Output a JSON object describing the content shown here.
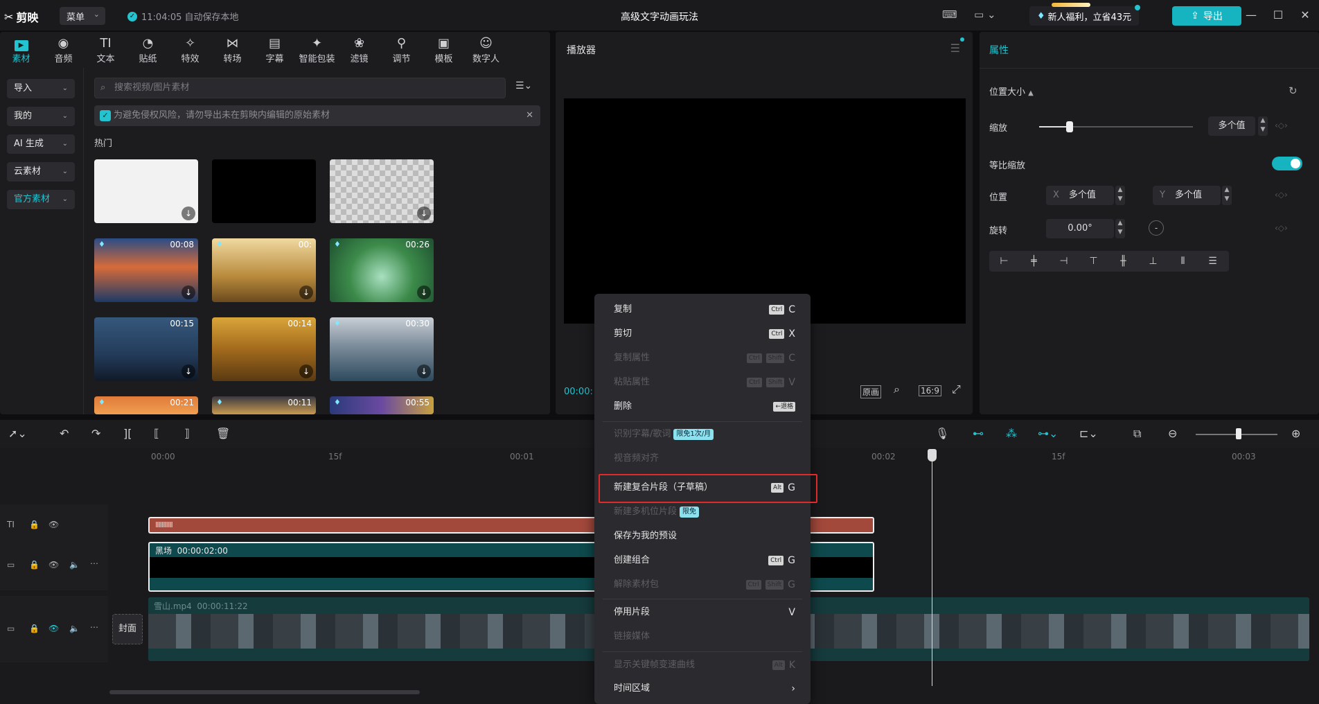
{
  "titlebar": {
    "app_name": "剪映",
    "menu_label": "菜单",
    "autosave_text": "11:04:05 自动保存本地",
    "window_title": "高级文字动画玩法",
    "promo_label": "新人福利，立省43元",
    "export_label": "导出"
  },
  "media_tabs": [
    {
      "label": "素材",
      "icon": "media-icon"
    },
    {
      "label": "音频",
      "icon": "audio-icon"
    },
    {
      "label": "文本",
      "icon": "text-icon"
    },
    {
      "label": "贴纸",
      "icon": "sticker-icon"
    },
    {
      "label": "特效",
      "icon": "effects-icon"
    },
    {
      "label": "转场",
      "icon": "transition-icon"
    },
    {
      "label": "字幕",
      "icon": "caption-icon"
    },
    {
      "label": "智能包装",
      "icon": "smart-pack-icon"
    },
    {
      "label": "滤镜",
      "icon": "filter-icon"
    },
    {
      "label": "调节",
      "icon": "adjust-icon"
    },
    {
      "label": "模板",
      "icon": "template-icon"
    },
    {
      "label": "数字人",
      "icon": "avatar-icon"
    }
  ],
  "sidebar": {
    "items": [
      {
        "label": "导入"
      },
      {
        "label": "我的"
      },
      {
        "label": "AI 生成"
      },
      {
        "label": "云素材"
      },
      {
        "label": "官方素材"
      }
    ]
  },
  "media": {
    "search_placeholder": "搜索视频/图片素材",
    "notice_text": "为避免侵权风险，请勿导出未在剪映内编辑的原始素材",
    "section_title": "热门",
    "thumbs": [
      {
        "duration": ""
      },
      {
        "duration": ""
      },
      {
        "duration": ""
      },
      {
        "duration": "00:08"
      },
      {
        "duration": "00:"
      },
      {
        "duration": "00:26"
      },
      {
        "duration": "00:15"
      },
      {
        "duration": "00:14"
      },
      {
        "duration": "00:30"
      },
      {
        "duration": "00:21"
      },
      {
        "duration": "00:11"
      },
      {
        "duration": "00:55"
      }
    ]
  },
  "player": {
    "title": "播放器",
    "current_time": "00:00:",
    "ctrl_original": "原画",
    "ctrl_ratio": "16:9"
  },
  "properties": {
    "title": "属性",
    "section": "位置大小",
    "scale_label": "缩放",
    "scale_value": "多个值",
    "scale_slider_fraction": 0.2,
    "uniform_label": "等比缩放",
    "position_label": "位置",
    "x_label": "X",
    "x_value": "多个值",
    "y_label": "Y",
    "y_value": "多个值",
    "rotate_label": "旋转",
    "rotate_value": "0.00°"
  },
  "timeline": {
    "ruler": [
      "00:00",
      "15f",
      "00:01",
      "00:02",
      "15f",
      "00:03"
    ],
    "text_clip_bars": "IIIIIIIIIII",
    "black_clip_label": "黑场",
    "black_clip_duration": "00:00:02:00",
    "video_clip_label": "雪山.mp4",
    "video_clip_duration": "00:00:11:22",
    "cover_label": "封面"
  },
  "context_menu": {
    "items": [
      {
        "label": "复制",
        "keys": [
          "Ctrl"
        ],
        "letter": "C",
        "disabled": false
      },
      {
        "label": "剪切",
        "keys": [
          "Ctrl"
        ],
        "letter": "X",
        "disabled": false
      },
      {
        "label": "复制属性",
        "keys": [
          "Ctrl",
          "Shift"
        ],
        "letter": "C",
        "disabled": true
      },
      {
        "label": "粘贴属性",
        "keys": [
          "Ctrl",
          "Shift"
        ],
        "letter": "V",
        "disabled": true
      },
      {
        "label": "删除",
        "keys": [
          "←退格"
        ],
        "letter": "",
        "disabled": false
      },
      {
        "label": "识别字幕/歌词",
        "badge": "限免1次/月",
        "disabled": true
      },
      {
        "label": "视音频对齐",
        "disabled": true
      },
      {
        "label": "新建复合片段（子草稿）",
        "keys": [
          "Alt"
        ],
        "letter": "G",
        "disabled": false
      },
      {
        "label": "新建多机位片段",
        "badge": "限免",
        "disabled": true
      },
      {
        "label": "保存为我的预设",
        "disabled": false
      },
      {
        "label": "创建组合",
        "keys": [
          "Ctrl"
        ],
        "letter": "G",
        "disabled": false
      },
      {
        "label": "解除素材包",
        "keys": [
          "Ctrl",
          "Shift"
        ],
        "letter": "G",
        "disabled": true
      },
      {
        "label": "停用片段",
        "letter": "V",
        "disabled": false
      },
      {
        "label": "链接媒体",
        "disabled": true
      },
      {
        "label": "显示关键帧变速曲线",
        "keys": [
          "Alt"
        ],
        "letter": "K",
        "disabled": true
      },
      {
        "label": "时间区域",
        "letter": "›",
        "disabled": false
      }
    ]
  },
  "colors": {
    "accent": "#23c4d0",
    "highlight_box": "#e12a2a",
    "text_clip": "#a3493c",
    "video_track": "#0e4a4d"
  }
}
